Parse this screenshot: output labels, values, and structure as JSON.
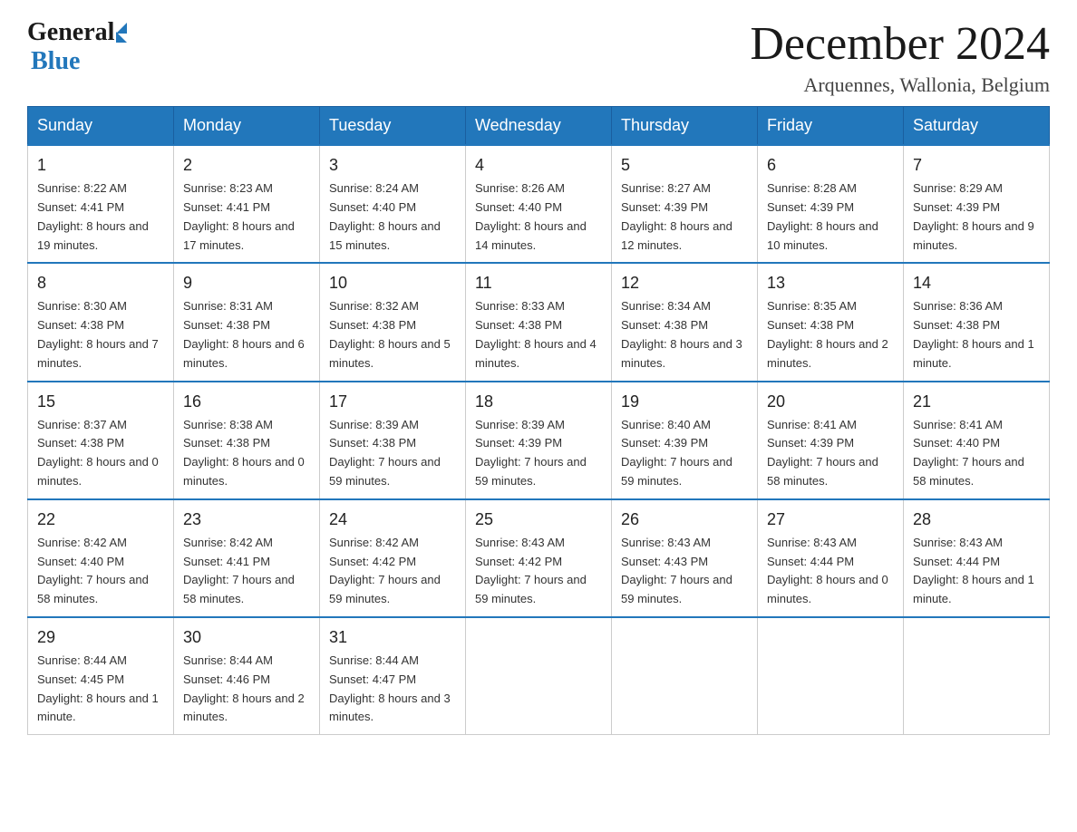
{
  "header": {
    "logo_general": "General",
    "logo_blue": "Blue",
    "title": "December 2024",
    "subtitle": "Arquennes, Wallonia, Belgium"
  },
  "columns": [
    "Sunday",
    "Monday",
    "Tuesday",
    "Wednesday",
    "Thursday",
    "Friday",
    "Saturday"
  ],
  "weeks": [
    [
      {
        "day": "1",
        "sunrise": "8:22 AM",
        "sunset": "4:41 PM",
        "daylight": "8 hours and 19 minutes."
      },
      {
        "day": "2",
        "sunrise": "8:23 AM",
        "sunset": "4:41 PM",
        "daylight": "8 hours and 17 minutes."
      },
      {
        "day": "3",
        "sunrise": "8:24 AM",
        "sunset": "4:40 PM",
        "daylight": "8 hours and 15 minutes."
      },
      {
        "day": "4",
        "sunrise": "8:26 AM",
        "sunset": "4:40 PM",
        "daylight": "8 hours and 14 minutes."
      },
      {
        "day": "5",
        "sunrise": "8:27 AM",
        "sunset": "4:39 PM",
        "daylight": "8 hours and 12 minutes."
      },
      {
        "day": "6",
        "sunrise": "8:28 AM",
        "sunset": "4:39 PM",
        "daylight": "8 hours and 10 minutes."
      },
      {
        "day": "7",
        "sunrise": "8:29 AM",
        "sunset": "4:39 PM",
        "daylight": "8 hours and 9 minutes."
      }
    ],
    [
      {
        "day": "8",
        "sunrise": "8:30 AM",
        "sunset": "4:38 PM",
        "daylight": "8 hours and 7 minutes."
      },
      {
        "day": "9",
        "sunrise": "8:31 AM",
        "sunset": "4:38 PM",
        "daylight": "8 hours and 6 minutes."
      },
      {
        "day": "10",
        "sunrise": "8:32 AM",
        "sunset": "4:38 PM",
        "daylight": "8 hours and 5 minutes."
      },
      {
        "day": "11",
        "sunrise": "8:33 AM",
        "sunset": "4:38 PM",
        "daylight": "8 hours and 4 minutes."
      },
      {
        "day": "12",
        "sunrise": "8:34 AM",
        "sunset": "4:38 PM",
        "daylight": "8 hours and 3 minutes."
      },
      {
        "day": "13",
        "sunrise": "8:35 AM",
        "sunset": "4:38 PM",
        "daylight": "8 hours and 2 minutes."
      },
      {
        "day": "14",
        "sunrise": "8:36 AM",
        "sunset": "4:38 PM",
        "daylight": "8 hours and 1 minute."
      }
    ],
    [
      {
        "day": "15",
        "sunrise": "8:37 AM",
        "sunset": "4:38 PM",
        "daylight": "8 hours and 0 minutes."
      },
      {
        "day": "16",
        "sunrise": "8:38 AM",
        "sunset": "4:38 PM",
        "daylight": "8 hours and 0 minutes."
      },
      {
        "day": "17",
        "sunrise": "8:39 AM",
        "sunset": "4:38 PM",
        "daylight": "7 hours and 59 minutes."
      },
      {
        "day": "18",
        "sunrise": "8:39 AM",
        "sunset": "4:39 PM",
        "daylight": "7 hours and 59 minutes."
      },
      {
        "day": "19",
        "sunrise": "8:40 AM",
        "sunset": "4:39 PM",
        "daylight": "7 hours and 59 minutes."
      },
      {
        "day": "20",
        "sunrise": "8:41 AM",
        "sunset": "4:39 PM",
        "daylight": "7 hours and 58 minutes."
      },
      {
        "day": "21",
        "sunrise": "8:41 AM",
        "sunset": "4:40 PM",
        "daylight": "7 hours and 58 minutes."
      }
    ],
    [
      {
        "day": "22",
        "sunrise": "8:42 AM",
        "sunset": "4:40 PM",
        "daylight": "7 hours and 58 minutes."
      },
      {
        "day": "23",
        "sunrise": "8:42 AM",
        "sunset": "4:41 PM",
        "daylight": "7 hours and 58 minutes."
      },
      {
        "day": "24",
        "sunrise": "8:42 AM",
        "sunset": "4:42 PM",
        "daylight": "7 hours and 59 minutes."
      },
      {
        "day": "25",
        "sunrise": "8:43 AM",
        "sunset": "4:42 PM",
        "daylight": "7 hours and 59 minutes."
      },
      {
        "day": "26",
        "sunrise": "8:43 AM",
        "sunset": "4:43 PM",
        "daylight": "7 hours and 59 minutes."
      },
      {
        "day": "27",
        "sunrise": "8:43 AM",
        "sunset": "4:44 PM",
        "daylight": "8 hours and 0 minutes."
      },
      {
        "day": "28",
        "sunrise": "8:43 AM",
        "sunset": "4:44 PM",
        "daylight": "8 hours and 1 minute."
      }
    ],
    [
      {
        "day": "29",
        "sunrise": "8:44 AM",
        "sunset": "4:45 PM",
        "daylight": "8 hours and 1 minute."
      },
      {
        "day": "30",
        "sunrise": "8:44 AM",
        "sunset": "4:46 PM",
        "daylight": "8 hours and 2 minutes."
      },
      {
        "day": "31",
        "sunrise": "8:44 AM",
        "sunset": "4:47 PM",
        "daylight": "8 hours and 3 minutes."
      },
      null,
      null,
      null,
      null
    ]
  ]
}
